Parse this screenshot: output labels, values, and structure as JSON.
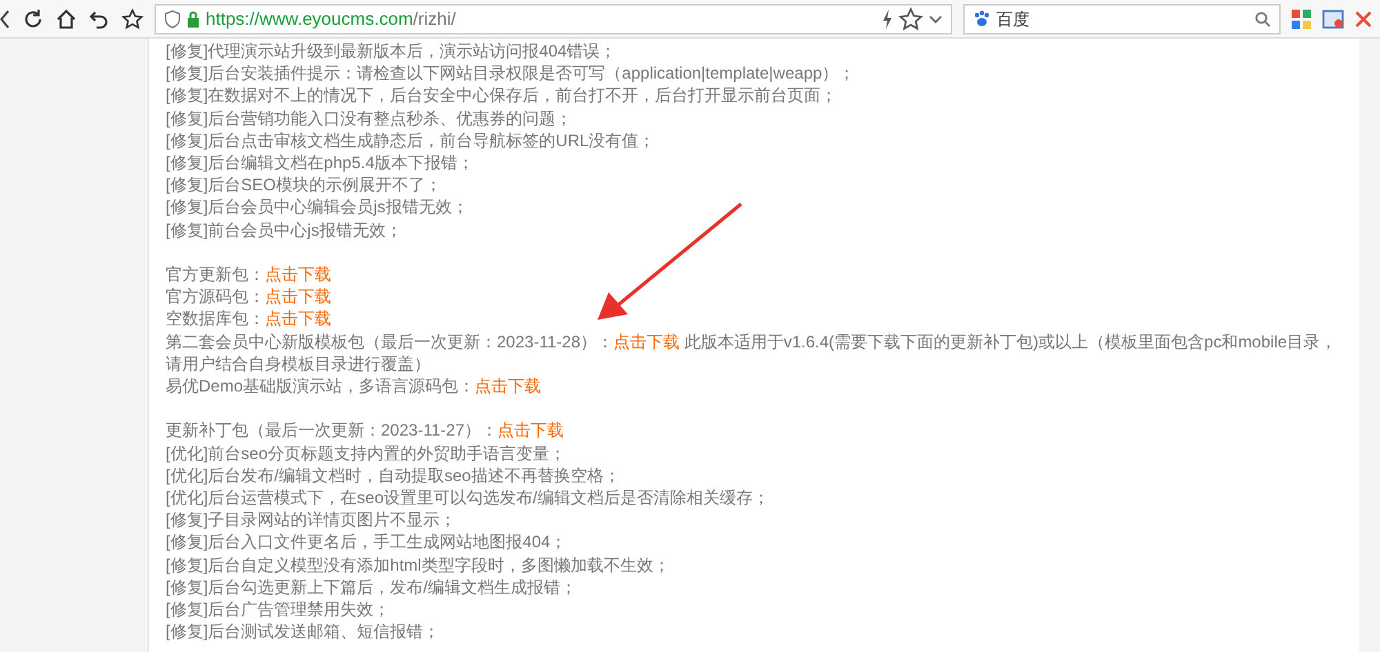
{
  "browser": {
    "url_scheme_host": "https://www.eyoucms.com",
    "url_path": "/rizhi/",
    "search_engine": "百度"
  },
  "sections": [
    {
      "lines": [
        {
          "kind": "text",
          "text": "[修复]代理演示站升级到最新版本后，演示站访问报404错误；"
        },
        {
          "kind": "text",
          "text": "[修复]后台安装插件提示：请检查以下网站目录权限是否可写（application|template|weapp）；"
        },
        {
          "kind": "text",
          "text": "[修复]在数据对不上的情况下，后台安全中心保存后，前台打不开，后台打开显示前台页面；"
        },
        {
          "kind": "text",
          "text": "[修复]后台营销功能入口没有整点秒杀、优惠券的问题；"
        },
        {
          "kind": "text",
          "text": "[修复]后台点击审核文档生成静态后，前台导航标签的URL没有值；"
        },
        {
          "kind": "text",
          "text": "[修复]后台编辑文档在php5.4版本下报错；"
        },
        {
          "kind": "text",
          "text": "[修复]后台SEO模块的示例展开不了；"
        },
        {
          "kind": "text",
          "text": "[修复]后台会员中心编辑会员js报错无效；"
        },
        {
          "kind": "text",
          "text": "[修复]前台会员中心js报错无效；"
        }
      ]
    },
    {
      "lines": [
        {
          "kind": "download",
          "label": "官方更新包：",
          "link": "点击下载"
        },
        {
          "kind": "download",
          "label": "官方源码包：",
          "link": "点击下载"
        },
        {
          "kind": "download",
          "label": "空数据库包：",
          "link": "点击下载"
        },
        {
          "kind": "download",
          "label": "第二套会员中心新版模板包（最后一次更新：2023-11-28）：",
          "link": "点击下载",
          "note": "此版本适用于v1.6.4(需要下载下面的更新补丁包)或以上（模板里面包含pc和mobile目录，请用户结合自身模板目录进行覆盖）"
        },
        {
          "kind": "download",
          "label": "易优Demo基础版演示站，多语言源码包：",
          "link": "点击下载"
        }
      ]
    },
    {
      "lines": [
        {
          "kind": "download",
          "label": "更新补丁包（最后一次更新：2023-11-27）：",
          "link": "点击下载"
        },
        {
          "kind": "text",
          "text": "[优化]前台seo分页标题支持内置的外贸助手语言变量；"
        },
        {
          "kind": "text",
          "text": "[优化]后台发布/编辑文档时，自动提取seo描述不再替换空格；"
        },
        {
          "kind": "text",
          "text": "[优化]后台运营模式下，在seo设置里可以勾选发布/编辑文档后是否清除相关缓存；"
        },
        {
          "kind": "text",
          "text": "[修复]子目录网站的详情页图片不显示；"
        },
        {
          "kind": "text",
          "text": "[修复]后台入口文件更名后，手工生成网站地图报404；"
        },
        {
          "kind": "text",
          "text": "[修复]后台自定义模型没有添加html类型字段时，多图懒加载不生效；"
        },
        {
          "kind": "text",
          "text": "[修复]后台勾选更新上下篇后，发布/编辑文档生成报错；"
        },
        {
          "kind": "text",
          "text": "[修复]后台广告管理禁用失效；"
        },
        {
          "kind": "text",
          "text": "[修复]后台测试发送邮箱、短信报错；"
        }
      ]
    }
  ]
}
